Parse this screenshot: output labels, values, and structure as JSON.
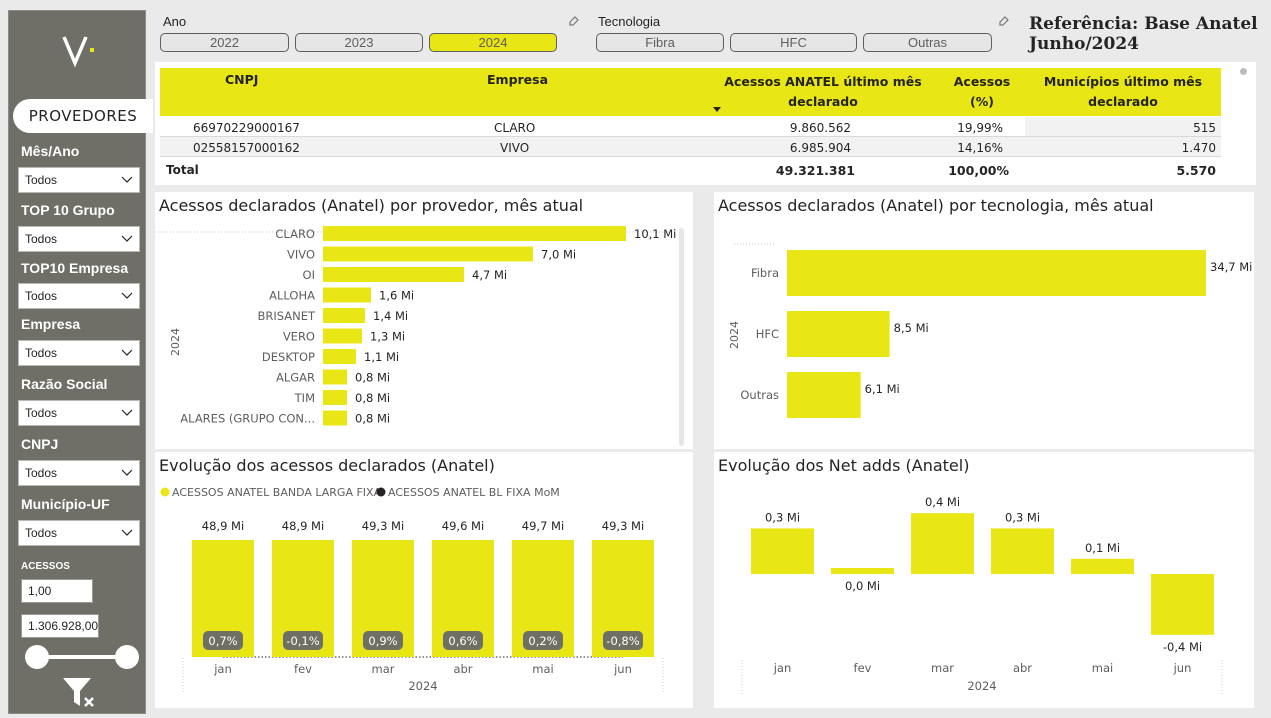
{
  "sidebar": {
    "tab_label": "PROVEDORES",
    "filters": [
      {
        "label": "Mês/Ano",
        "value": "Todos"
      },
      {
        "label": "TOP 10 Grupo",
        "value": "Todos"
      },
      {
        "label": "TOP10 Empresa",
        "value": "Todos"
      },
      {
        "label": "Empresa",
        "value": "Todos"
      },
      {
        "label": "Razão Social",
        "value": "Todos"
      },
      {
        "label": "CNPJ",
        "value": "Todos"
      },
      {
        "label": "Município-UF",
        "value": "Todos"
      }
    ],
    "acessos_label": "ACESSOS",
    "acessos_min": "1,00",
    "acessos_max": "1.306.928,00",
    "range_slider": {
      "min_fraction": 0,
      "max_fraction": 1
    }
  },
  "slicers": {
    "ano": {
      "title": "Ano",
      "options": [
        "2022",
        "2023",
        "2024"
      ],
      "selected": "2024"
    },
    "tecnologia": {
      "title": "Tecnologia",
      "options": [
        "Fibra",
        "HFC",
        "Outras"
      ]
    }
  },
  "reference": {
    "line1": "Referência: Base Anatel",
    "line2": "Junho/2024"
  },
  "table": {
    "headers": {
      "cnpj": "CNPJ",
      "empresa": "Empresa",
      "acessos_l1": "Acessos ANATEL último mês",
      "acessos_l2": "declarado",
      "pct_l1": "Acessos",
      "pct_l2": "(%)",
      "mun_l1": "Municípios último mês",
      "mun_l2": "declarado"
    },
    "rows": [
      {
        "cnpj": "66970229000167",
        "empresa": "CLARO",
        "acessos": "9.860.562",
        "pct": "19,99%",
        "municipios": "515"
      },
      {
        "cnpj": "02558157000162",
        "empresa": "VIVO",
        "acessos": "6.985.904",
        "pct": "14,16%",
        "municipios": "1.470"
      }
    ],
    "total": {
      "label": "Total",
      "acessos": "49.321.381",
      "pct": "100,00%",
      "municipios": "5.570"
    }
  },
  "colors": {
    "accent": "#e8e614",
    "sidebar": "#6f6f67",
    "mom_badge": "#6f6f63"
  },
  "cards": {
    "provider": {
      "title": "Acessos declarados (Anatel) por provedor, mês atual"
    },
    "tech": {
      "title": "Acessos declarados (Anatel) por tecnologia, mês atual"
    },
    "evolution": {
      "title": "Evolução dos acessos declarados (Anatel)"
    },
    "netadds": {
      "title": "Evolução dos Net adds (Anatel)"
    }
  },
  "chart_data": [
    {
      "type": "bar",
      "orientation": "horizontal",
      "group_label": "2024",
      "categories": [
        "CLARO",
        "VIVO",
        "OI",
        "ALLOHA",
        "BRISANET",
        "VERO",
        "DESKTOP",
        "ALGAR",
        "TIM",
        "ALARES (GRUPO CON..."
      ],
      "values": [
        10.1,
        7.0,
        4.7,
        1.6,
        1.4,
        1.3,
        1.1,
        0.8,
        0.8,
        0.8
      ],
      "labels": [
        "10,1 Mi",
        "7,0 Mi",
        "4,7 Mi",
        "1,6 Mi",
        "1,4 Mi",
        "1,3 Mi",
        "1,1 Mi",
        "0,8 Mi",
        "0,8 Mi",
        "0,8 Mi"
      ],
      "unit": "Mi"
    },
    {
      "type": "bar",
      "orientation": "horizontal",
      "group_label": "2024",
      "categories": [
        "Fibra",
        "HFC",
        "Outras"
      ],
      "values": [
        34.7,
        8.5,
        6.1
      ],
      "labels": [
        "34,7 Mi",
        "8,5 Mi",
        "6,1 Mi"
      ],
      "unit": "Mi"
    },
    {
      "type": "bar",
      "categories": [
        "jan",
        "fev",
        "mar",
        "abr",
        "mai",
        "jun"
      ],
      "xlabel": "2024",
      "legend": [
        "ACESSOS ANATEL BANDA LARGA FIXA",
        "ACESSOS ANATEL BL FIXA MoM"
      ],
      "series": [
        {
          "name": "ACESSOS ANATEL BANDA LARGA FIXA",
          "values": [
            48.9,
            48.9,
            49.3,
            49.6,
            49.7,
            49.3
          ],
          "labels": [
            "48,9 Mi",
            "48,9 Mi",
            "49,3 Mi",
            "49,6 Mi",
            "49,7 Mi",
            "49,3 Mi"
          ]
        },
        {
          "name": "ACESSOS ANATEL BL FIXA MoM",
          "values": [
            0.7,
            -0.1,
            0.9,
            0.6,
            0.2,
            -0.8
          ],
          "labels": [
            "0,7%",
            "-0,1%",
            "0,9%",
            "0,6%",
            "0,2%",
            "-0,8%"
          ]
        }
      ]
    },
    {
      "type": "bar",
      "categories": [
        "jan",
        "fev",
        "mar",
        "abr",
        "mai",
        "jun"
      ],
      "xlabel": "2024",
      "values": [
        0.3,
        0.0,
        0.4,
        0.3,
        0.1,
        -0.4
      ],
      "labels": [
        "0,3 Mi",
        "0,0 Mi",
        "0,4 Mi",
        "0,3 Mi",
        "0,1 Mi",
        "-0,4 Mi"
      ]
    }
  ]
}
